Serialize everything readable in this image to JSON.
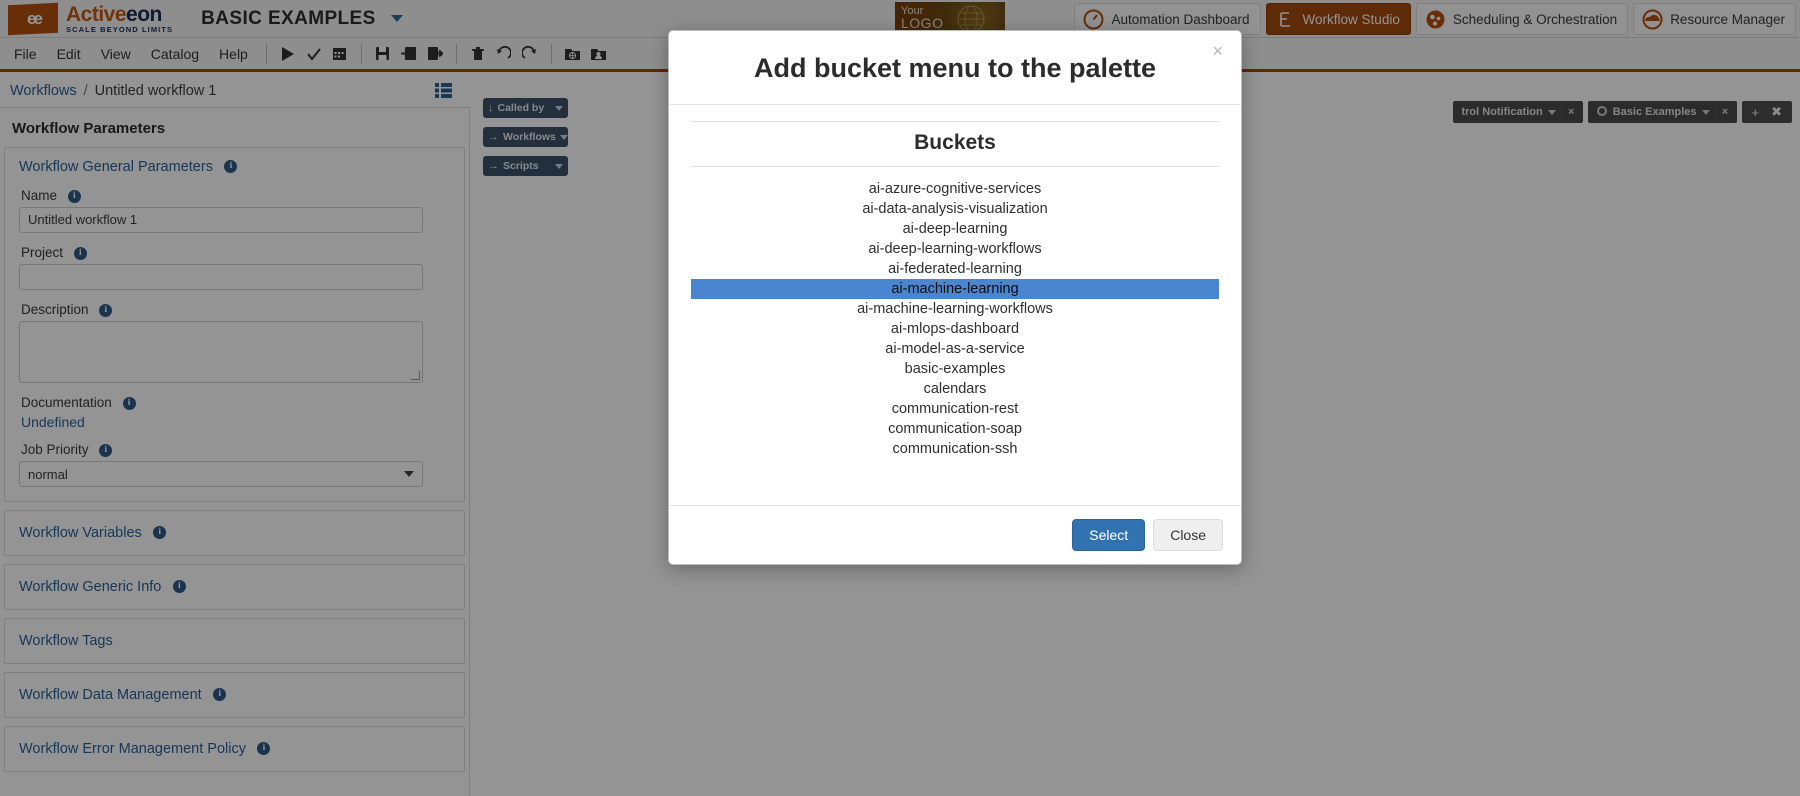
{
  "brand": {
    "mark": "ee",
    "name_part1": "Active",
    "name_part2": "eon",
    "tagline": "SCALE BEYOND LIMITS",
    "app_name": "BASIC EXAMPLES"
  },
  "logo_placeholder": {
    "line1": "Your",
    "line2": "LOGO"
  },
  "nav": {
    "items": [
      {
        "label": "Automation Dashboard",
        "icon": "gauge-icon",
        "active": false,
        "color": "#b4500f"
      },
      {
        "label": "Workflow Studio",
        "icon": "workflow-icon",
        "active": true,
        "color": "#ffffff"
      },
      {
        "label": "Scheduling & Orchestration",
        "icon": "gears-icon",
        "active": false,
        "color": "#b4500f"
      },
      {
        "label": "Resource Manager",
        "icon": "cloud-icon",
        "active": false,
        "color": "#b4500f"
      }
    ]
  },
  "menubar": {
    "items": [
      "File",
      "Edit",
      "View",
      "Catalog",
      "Help"
    ],
    "tools": [
      {
        "name": "execute-icon",
        "glyph": "▶"
      },
      {
        "name": "validate-icon",
        "glyph": "✔"
      },
      {
        "name": "schedule-icon",
        "glyph": "☷"
      },
      {
        "name": "save-icon",
        "glyph": "ὋE"
      },
      {
        "name": "import-icon",
        "glyph": "⬅"
      },
      {
        "name": "export-icon",
        "glyph": "➡"
      },
      {
        "name": "delete-icon",
        "glyph": "Ὕ1"
      },
      {
        "name": "undo-icon",
        "glyph": "↶"
      },
      {
        "name": "redo-icon",
        "glyph": "↷"
      },
      {
        "name": "public-catalog-icon",
        "glyph": "ἱ0"
      },
      {
        "name": "my-catalog-icon",
        "glyph": "὆4"
      }
    ]
  },
  "breadcrumb": {
    "root": "Workflows",
    "separator": "/",
    "current": "Untitled workflow 1"
  },
  "left_panel": {
    "title": "Workflow Parameters",
    "general_section": {
      "title": "Workflow General Parameters",
      "fields": {
        "name_label": "Name",
        "name_value": "Untitled workflow 1",
        "project_label": "Project",
        "project_value": "",
        "description_label": "Description",
        "description_value": "",
        "documentation_label": "Documentation",
        "documentation_value": "Undefined",
        "job_priority_label": "Job Priority",
        "job_priority_value": "normal"
      }
    },
    "sections": [
      {
        "label": "Workflow Variables",
        "has_info": true
      },
      {
        "label": "Workflow Generic Info",
        "has_info": true
      },
      {
        "label": "Workflow Tags",
        "has_info": false
      },
      {
        "label": "Workflow Data Management",
        "has_info": true
      },
      {
        "label": "Workflow Error Management Policy",
        "has_info": true
      }
    ]
  },
  "palette": {
    "buttons": [
      {
        "label": "Called by",
        "arrow": "↓"
      },
      {
        "label": "Workflows",
        "arrow": "→"
      },
      {
        "label": "Scripts",
        "arrow": "→"
      }
    ]
  },
  "workflow_tabs": {
    "tabs": [
      {
        "label": "trol Notification",
        "close": "×"
      },
      {
        "label": "Basic Examples",
        "close": "×"
      }
    ],
    "add_label": "+",
    "pin_label": "✖"
  },
  "modal": {
    "title": "Add bucket menu to the palette",
    "close_glyph": "×",
    "section_title": "Buckets",
    "buckets": [
      "ai-azure-cognitive-services",
      "ai-data-analysis-visualization",
      "ai-deep-learning",
      "ai-deep-learning-workflows",
      "ai-federated-learning",
      "ai-machine-learning",
      "ai-machine-learning-workflows",
      "ai-mlops-dashboard",
      "ai-model-as-a-service",
      "basic-examples",
      "calendars",
      "communication-rest",
      "communication-soap",
      "communication-ssh"
    ],
    "selected_bucket": "ai-machine-learning",
    "selected_index": 5,
    "select_button": "Select",
    "close_button": "Close",
    "selection_color": "#4a86d0",
    "primary_color": "#3173b0"
  }
}
